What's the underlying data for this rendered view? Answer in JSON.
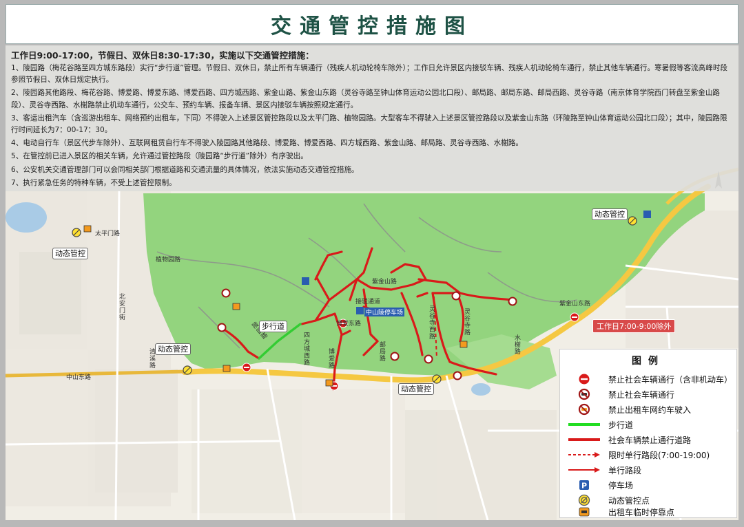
{
  "title": "交通管控措施图",
  "notice": {
    "heading": "工作日9:00-17:00，节假日、双休日8:30-17:30，实施以下交通管控措施：",
    "items": [
      "1、陵园路（梅花谷路至四方城东路段）实行“步行道”管理。节假日、双休日，禁止所有车辆通行（残疾人机动轮椅车除外）；工作日允许景区内接驳车辆、残疾人机动轮椅车通行，禁止其他车辆通行。寒暑假等客流高峰时段参照节假日、双休日规定执行。",
      "2、陵园路其他路段、梅花谷路、博爱路、博爱东路、博爱西路、四方城西路、紫金山路、紫金山东路（灵谷寺路至钟山体育运动公园北口段）、邮局路、邮局东路、邮局西路、灵谷寺路（南京体育学院西门转盘至紫金山路段）、灵谷寺西路、水榭路禁止机动车通行，公交车、预约车辆、报备车辆、景区内接驳车辆按照规定通行。",
      "3、客运出租汽车（含巡游出租车、网络预约出租车，下同）不得驶入上述景区管控路段以及太平门路、植物园路。大型客车不得驶入上述景区管控路段以及紫金山东路（环陵路至钟山体育运动公园北口段）；其中，陵园路限行时间延长为7：00-17：30。",
      "4、电动自行车（景区代步车除外）、互联网租赁自行车不得驶入陵园路其他路段、博爱路、博爱西路、四方城西路、紫金山路、邮局路、灵谷寺西路、水榭路。",
      "5、在管控前已进入景区的相关车辆，允许通过管控路段（陵园路“步行道”除外）有序驶出。",
      "6、公安机关交通管理部门可以会同相关部门根据道路和交通流量的具体情况，依法实施动态交通管控措施。",
      "7、执行紧急任务的特种车辆，不受上述管控限制。"
    ]
  },
  "map": {
    "control_points": [
      "动态管控",
      "动态管控",
      "动态管控",
      "动态管控"
    ],
    "walkway_label": "步行道",
    "workday_note": "工作日7:00-9:00除外",
    "roads": {
      "zijinshan_dong": "紫金山东路",
      "lingyuan": "陵园路",
      "bo_ai_dong": "博爱东路",
      "bo_ai": "博爱路",
      "lingguyi": "灵谷寺路",
      "lingguyi_xi": "灵谷寺西路",
      "zijinshan": "紫金山路",
      "zhiwuyuan": "植物园路",
      "taipingmen": "太平门路",
      "zhongshandong": "中山东路",
      "jiebo": "接驳通道",
      "zhongshanling_park": "中山陵停车场",
      "beianmen": "北安门街",
      "qingxi": "清溪路",
      "sifangcheng_xi": "四方城西路",
      "shuixie": "水榭路",
      "youju": "邮局路"
    }
  },
  "legend": {
    "title": "图例",
    "items": [
      {
        "icon": "no-vehicle-icon",
        "label": "禁止社会车辆通行（含非机动车）"
      },
      {
        "icon": "no-car-icon",
        "label": "禁止社会车辆通行"
      },
      {
        "icon": "no-taxi-icon",
        "label": "禁止出租车网约车驶入"
      },
      {
        "icon": "walkway-line-icon",
        "label": "步行道"
      },
      {
        "icon": "restricted-road-line-icon",
        "label": "社会车辆禁止通行道路"
      },
      {
        "icon": "timed-oneway-dashed-arrow-icon",
        "label": "限时单行路段(7:00-19:00)"
      },
      {
        "icon": "oneway-arrow-icon",
        "label": "单行路段"
      },
      {
        "icon": "parking-icon",
        "label": "停车场"
      },
      {
        "icon": "dynamic-control-point-icon",
        "label": "动态管控点"
      },
      {
        "icon": "taxi-stop-icon",
        "label": "出租车临时停靠点"
      }
    ]
  },
  "colors": {
    "title": "#1e5245",
    "park_green": "#93d47e",
    "restricted_red": "#d91a1a",
    "walkway_green": "#33cc33",
    "main_road_yellow": "#f5c842",
    "background": "#f1eee6"
  }
}
